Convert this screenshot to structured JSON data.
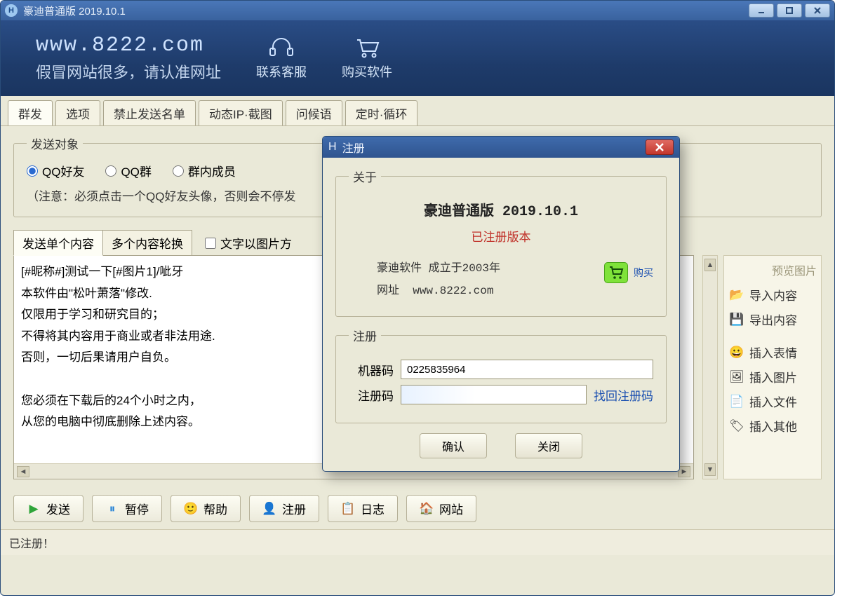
{
  "window": {
    "title": "豪迪普通版 2019.10.1"
  },
  "banner": {
    "url": "www.8222.com",
    "slogan": "假冒网站很多，请认准网址",
    "contact": "联系客服",
    "buy": "购买软件"
  },
  "tabs": [
    "群发",
    "选项",
    "禁止发送名单",
    "动态IP·截图",
    "问候语",
    "定时·循环"
  ],
  "sendTarget": {
    "legend": "发送对象",
    "options": [
      "QQ好友",
      "QQ群",
      "群内成员"
    ],
    "note": "（注意：必须点击一个QQ好友头像，否则会不停发"
  },
  "subTabs": [
    "发送单个内容",
    "多个内容轮换"
  ],
  "checkbox_textAsImage": "文字以图片方",
  "editor_text": "[#昵称#]测试一下[#图片1]/呲牙\n本软件由\"松叶萧落\"修改.\n仅限用于学习和研究目的；\n不得将其内容用于商业或者非法用途.\n否则，一切后果请用户自负。\n\n您必须在下载后的24个小时之内，\n从您的电脑中彻底删除上述内容。",
  "sidePanel": {
    "title": "预览图片",
    "items": [
      "导入内容",
      "导出内容",
      "插入表情",
      "插入图片",
      "插入文件",
      "插入其他"
    ]
  },
  "bottomButtons": [
    "发送",
    "暂停",
    "帮助",
    "注册",
    "日志",
    "网站"
  ],
  "status": "已注册！",
  "dialog": {
    "title": "注册",
    "about": {
      "legend": "关于",
      "product": "豪迪普通版  2019.10.1",
      "registered": "已注册版本",
      "company": "豪迪软件  成立于2003年",
      "site_label": "网址",
      "site": "www.8222.com",
      "buy": "购买"
    },
    "reg": {
      "legend": "注册",
      "machine_label": "机器码",
      "machine_code": "0225835964",
      "code_label": "注册码",
      "recover": "找回注册码"
    },
    "buttons": {
      "ok": "确认",
      "close": "关闭"
    }
  }
}
